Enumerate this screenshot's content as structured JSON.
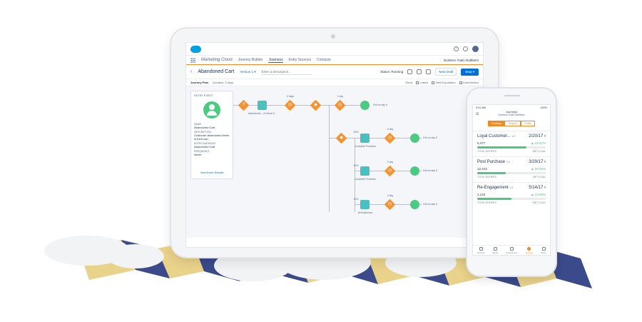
{
  "app": {
    "name": "Marketing Cloud",
    "breadcrumb": "Journey Builder",
    "tabs": [
      "Journeys",
      "Entry Sources",
      "Contacts"
    ],
    "active_tab": "Journeys",
    "org": "Northern Trails Outfitters",
    "help_glyph": "?"
  },
  "journey": {
    "name": "Abandoned Cart",
    "version": "Version 1 ▾",
    "description_placeholder": "Enter a description...",
    "status": "Status: Running",
    "new_draft": "New Draft",
    "stop": "Stop ▾",
    "plan_title": "Journey Plan",
    "plan_duration": "Duration: 5 days",
    "show_label": "Show",
    "show_options": [
      "Labels",
      "Total Population",
      "Goal Metrics"
    ]
  },
  "entry": {
    "eyebrow": "ENTRY EVENT",
    "name": "Abandoned Cart",
    "name_key": "NAME",
    "desc_key": "DESCRIPTION",
    "desc_val": "Customer abandoned items in their cart",
    "aud_key": "ENTRY AUDIENCE",
    "aud_val": "Abandoned Cart",
    "freq_key": "FREQUENCY",
    "freq_val": "Never",
    "link": "View Event Results"
  },
  "flow": {
    "question_glyph": "?",
    "split_glyph": "◆",
    "wait_glyph": "◷",
    "email_label": "Abandoned ...A Virtual S...",
    "wait1": "2 days",
    "wait2": "1 day",
    "wait3": "2 day",
    "branch_pcts": [
      "40%",
      "40%",
      "20%"
    ],
    "branch_labels": [
      "Complete Purchase",
      "Complete Purchase",
      "All Audiences"
    ],
    "exit_label": "Exit on day 5"
  },
  "phone": {
    "time": "9:41 AM",
    "battery": "100%",
    "title": "Journeys",
    "subtitle": "Northern Trails Outfitters",
    "menu_glyph": "☰",
    "segments": [
      "Running",
      "Stopped",
      "Drafts"
    ],
    "active_segment": "Running",
    "journeys": [
      {
        "name": "Loyal Customer...",
        "ver": "V2",
        "date": "2/20/17",
        "entries": "6,477",
        "entries_label": "TOTAL ENTRIES",
        "pct": "▲ 43.52%",
        "pct_label": "MET GOAL",
        "progress": 0.72
      },
      {
        "name": "Post Purchase",
        "ver": "V1",
        "date": "3/29/17",
        "entries": "12,413",
        "entries_label": "TOTAL ENTRIES",
        "pct": "▲ 29.46%",
        "pct_label": "MET GOAL",
        "progress": 0.42
      },
      {
        "name": "Re-Engagement",
        "ver": "V1",
        "date": "5/14/17",
        "entries": "1,144",
        "entries_label": "TOTAL ENTRIES",
        "pct": "▲ 43.98%",
        "pct_label": "MET GOAL",
        "progress": 0.5
      }
    ],
    "tabs": [
      "Discover",
      "Email",
      "Automations",
      "Journeys",
      "More"
    ],
    "active_tab": "Journeys"
  },
  "colors": {
    "accent": "#0070d2",
    "orange": "#f59331",
    "green": "#4bca81",
    "teal": "#4bc0c0",
    "ribbon_navy": "#3a4a8a",
    "ribbon_tan": "#e9d28a"
  }
}
